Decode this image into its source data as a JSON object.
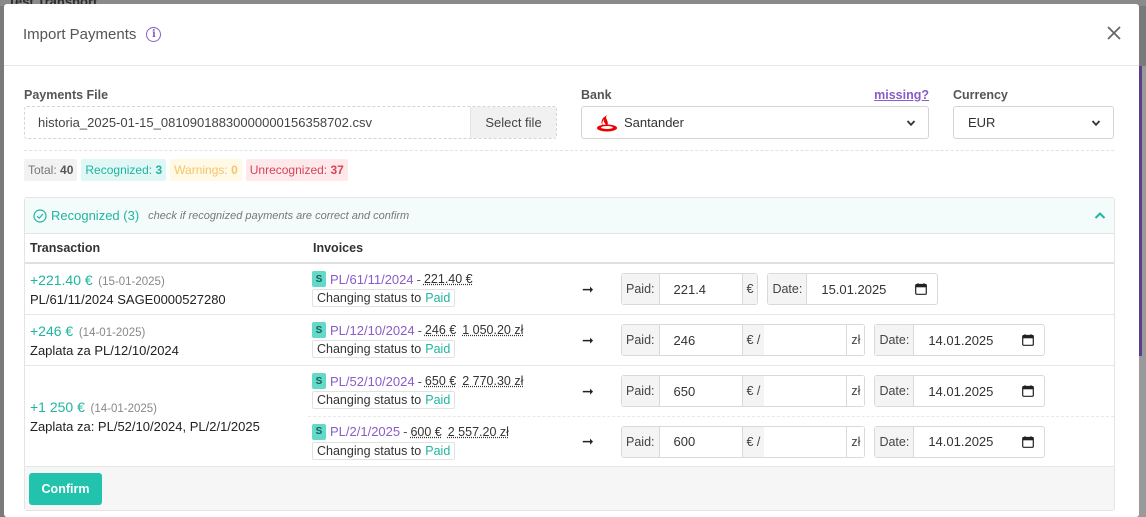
{
  "backdrop": {
    "title": "Test Transport"
  },
  "modal": {
    "title": "Import Payments",
    "info_icon": "info-icon",
    "close_icon": "close-icon"
  },
  "payments_file": {
    "label": "Payments File",
    "filename": "historia_2025-01-15_08109018830000000156358702.csv",
    "select_button": "Select file"
  },
  "bank": {
    "label": "Bank",
    "missing_link": "missing?",
    "selected": "Santander",
    "logo_icon": "santander-flame-icon"
  },
  "currency": {
    "label": "Currency",
    "selected": "EUR"
  },
  "summary": {
    "total_label": "Total:",
    "total": "40",
    "recognized_label": "Recognized:",
    "recognized": "3",
    "warnings_label": "Warnings:",
    "warnings": "0",
    "unrecognized_label": "Unrecognized:",
    "unrecognized": "37"
  },
  "recognized_panel": {
    "title": "Recognized (3)",
    "hint": "check if recognized payments are correct and confirm",
    "col_transaction": "Transaction",
    "col_invoices": "Invoices",
    "confirm_button": "Confirm",
    "rows": [
      {
        "amount": "+221.40 €",
        "date": "(15-01-2025)",
        "description": "PL/61/11/2024 SAGE0000527280",
        "invoices": [
          {
            "badge": "S",
            "number": "PL/61/11/2024",
            "dash": "-",
            "amount1": "221.40 €",
            "amount2": "",
            "status_prefix": "Changing status to",
            "status": "Paid",
            "paid_label": "Paid:",
            "paid_value": "221.4",
            "currency_addon": "€",
            "pln_addon": "",
            "pln_value": "",
            "date_label": "Date:",
            "date_value": "15.01.2025"
          }
        ]
      },
      {
        "amount": "+246 €",
        "date": "(14-01-2025)",
        "description": "Zaplata za PL/12/10/2024",
        "invoices": [
          {
            "badge": "S",
            "number": "PL/12/10/2024",
            "dash": "-",
            "amount1": "246 €",
            "amount2": "1 050.20 zł",
            "status_prefix": "Changing status to",
            "status": "Paid",
            "paid_label": "Paid:",
            "paid_value": "246",
            "currency_addon": "€ /",
            "pln_addon": "zł",
            "pln_value": "",
            "date_label": "Date:",
            "date_value": "14.01.2025"
          }
        ]
      },
      {
        "amount": "+1 250 €",
        "date": "(14-01-2025)",
        "description": "Zaplata za: PL/52/10/2024, PL/2/1/2025",
        "invoices": [
          {
            "badge": "S",
            "number": "PL/52/10/2024",
            "dash": "-",
            "amount1": "650 €",
            "amount2": "2 770.30 zł",
            "status_prefix": "Changing status to",
            "status": "Paid",
            "paid_label": "Paid:",
            "paid_value": "650",
            "currency_addon": "€ /",
            "pln_addon": "zł",
            "pln_value": "",
            "date_label": "Date:",
            "date_value": "14.01.2025"
          },
          {
            "badge": "S",
            "number": "PL/2/1/2025",
            "dash": "-",
            "amount1": "600 €",
            "amount2": "2 557.20 zł",
            "status_prefix": "Changing status to",
            "status": "Paid",
            "paid_label": "Paid:",
            "paid_value": "600",
            "currency_addon": "€ /",
            "pln_addon": "zł",
            "pln_value": "",
            "date_label": "Date:",
            "date_value": "14.01.2025"
          }
        ]
      }
    ]
  },
  "colors": {
    "accent_teal": "#1fb5a0",
    "accent_purple": "#8a5cc7",
    "danger": "#d9435a",
    "warning": "#f5c46a"
  }
}
